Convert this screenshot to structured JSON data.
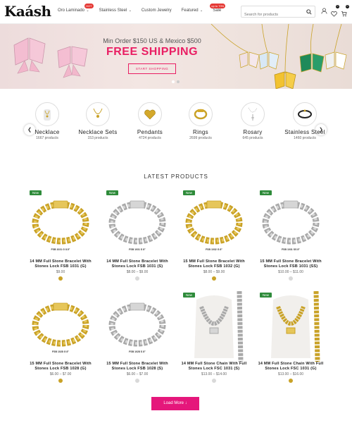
{
  "header": {
    "logo": "Kaásh",
    "nav": [
      {
        "label": "Oro Laminado",
        "chevron": true,
        "badge": "HOT"
      },
      {
        "label": "Stainless Steel",
        "chevron": true,
        "badge": ""
      },
      {
        "label": "Custom Jewelry",
        "chevron": false,
        "badge": ""
      },
      {
        "label": "Featured",
        "chevron": true,
        "badge": ""
      },
      {
        "label": "Sale",
        "chevron": false,
        "badge": "up to 70%"
      }
    ],
    "search_placeholder": "Search for products",
    "wishlist_count": "0",
    "cart_count": "0"
  },
  "hero": {
    "line1": "Min Order $150 US & Mexico $500",
    "line2": "FREE SHIPPING",
    "button": "START SHOPPING"
  },
  "categories": [
    {
      "name": "Necklace",
      "count": "1667 products",
      "icon": "necklace-icon"
    },
    {
      "name": "Necklace Sets",
      "count": "153 products",
      "icon": "necklace-set-icon"
    },
    {
      "name": "Pendants",
      "count": "4724 products",
      "icon": "pendant-icon"
    },
    {
      "name": "Rings",
      "count": "2699 products",
      "icon": "ring-icon"
    },
    {
      "name": "Rosary",
      "count": "645 products",
      "icon": "rosary-icon"
    },
    {
      "name": "Stainless Steel",
      "count": "1460 products",
      "icon": "bracelet-icon"
    }
  ],
  "section_title": "LATEST PRODUCTS",
  "products": [
    {
      "badge": "New",
      "code": "FSB 1031 G 8.5\"",
      "title": "14 MM Full Stone Bracelet With Stones Lock FSB 1031 (G)",
      "price": "$9.00",
      "swatch": "#c9a227",
      "metal": "gold"
    },
    {
      "badge": "New",
      "code": "FSB 1031 S 8\"",
      "title": "14 MM Full Stone Bracelet With Stones Lock FSB 1031 (S)",
      "price": "$8.00 – $9.00",
      "swatch": "#d9d9d9",
      "metal": "silver"
    },
    {
      "badge": "New",
      "code": "FSB 1032 G 8\"",
      "title": "15 MM Full Stone Bracelet With Stones Lock FSB 1032 (G)",
      "price": "$8.00 – $9.00",
      "swatch": "#c9a227",
      "metal": "gold"
    },
    {
      "badge": "New",
      "code": "FSB 1031 SS 8\"",
      "title": "15 MM Full Stone Bracelet With Stones Lock FSB 1031 (SS)",
      "price": "$10.00 – $11.00",
      "swatch": "#d9d9d9",
      "metal": "silver"
    },
    {
      "badge": "",
      "code": "FSB 1028 G 8\"",
      "title": "15 MM Full Stone Bracelet With Stones Lock FSB 1028 (G)",
      "price": "$6.00 – $7.00",
      "swatch": "#c9a227",
      "metal": "gold"
    },
    {
      "badge": "",
      "code": "FSB 1028 S 8\"",
      "title": "15 MM Full Stone Bracelet With Stones Lock FSB 1028 (S)",
      "price": "$6.00 – $7.00",
      "swatch": "#d9d9d9",
      "metal": "silver"
    },
    {
      "badge": "New",
      "code": "",
      "title": "14 MM Full Stone Chain With Full Stones Lock FSC 1031 (S)",
      "price": "$13.00 – $14.00",
      "swatch": "#d9d9d9",
      "metal": "silver-chain"
    },
    {
      "badge": "New",
      "code": "",
      "title": "14 MM Full Stone Chain With Full Stones Lock FSC 1031 (G)",
      "price": "$13.00 – $16.00",
      "swatch": "#c9a227",
      "metal": "gold-chain"
    }
  ],
  "load_more": "Load More ↓",
  "colors": {
    "accent": "#e91e63",
    "new_badge": "#2e8b3a",
    "gold": "#c9a227",
    "silver": "#d9d9d9"
  }
}
